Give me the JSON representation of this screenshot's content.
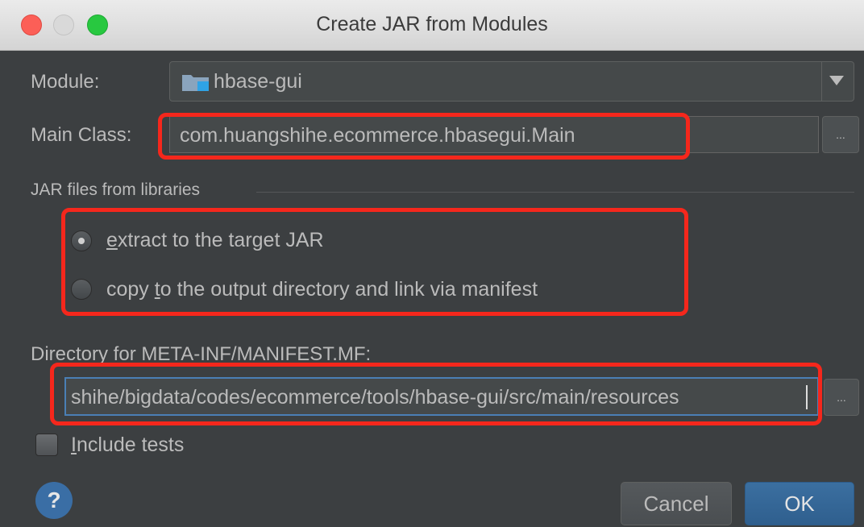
{
  "window": {
    "title": "Create JAR from Modules"
  },
  "module": {
    "label": "Module:",
    "value": "hbase-gui",
    "icon": "module-folder-icon"
  },
  "main_class": {
    "label": "Main Class:",
    "value": "com.huangshihe.ecommerce.hbasegui.Main",
    "browse_label": "..."
  },
  "libraries": {
    "group_title": "JAR files from libraries",
    "options": [
      {
        "pre": "",
        "mnemonic": "e",
        "post": "xtract to the target JAR",
        "selected": true
      },
      {
        "pre": "copy ",
        "mnemonic": "t",
        "post": "o the output directory and link via manifest",
        "selected": false
      }
    ]
  },
  "manifest": {
    "label": "Directory for META-INF/MANIFEST.MF:",
    "value": "shihe/bigdata/codes/ecommerce/tools/hbase-gui/src/main/resources",
    "browse_label": "..."
  },
  "include_tests": {
    "mnemonic": "I",
    "post": "nclude tests",
    "checked": false
  },
  "footer": {
    "help_label": "?",
    "cancel_label": "Cancel",
    "ok_label": "OK"
  },
  "colors": {
    "background": "#3c3f41",
    "highlight": "#f5271c",
    "ok_button": "#3b6fa0"
  }
}
